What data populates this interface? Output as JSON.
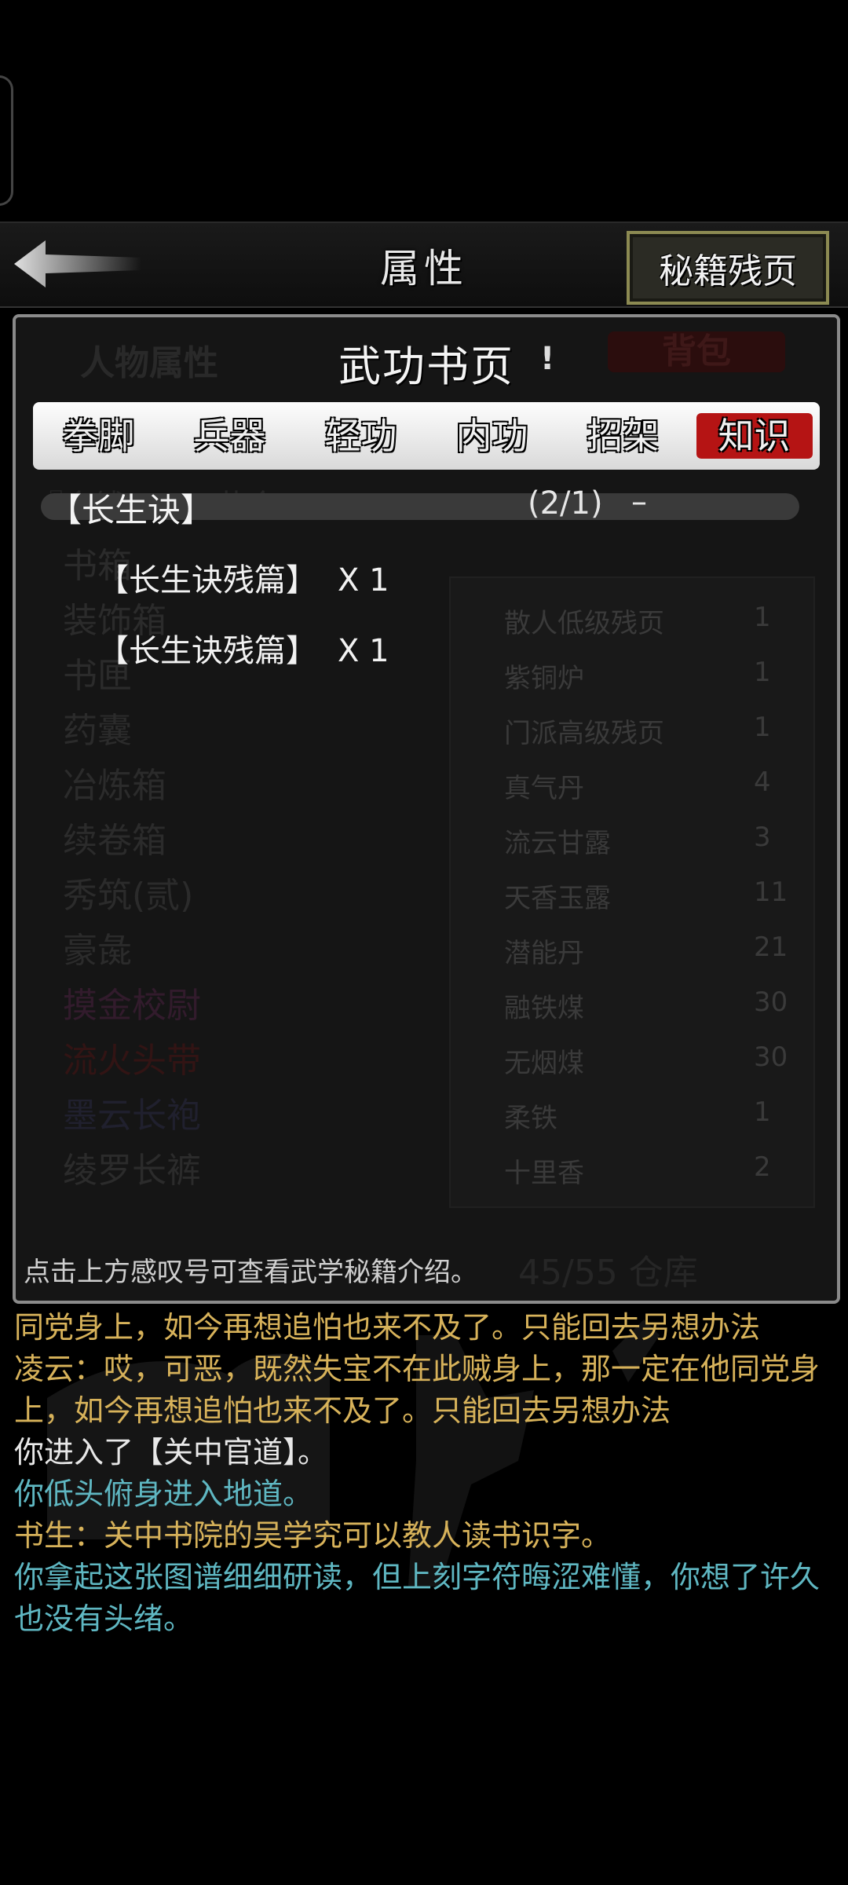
{
  "header": {
    "title": "属性",
    "secret_pages_button": "秘籍残页"
  },
  "background_panel": {
    "left_tab": "人物属性",
    "right_tab": "背包",
    "partial_line": "『金钱...745黄金...",
    "rows": [
      "书箱",
      "装饰箱",
      "书匣",
      "药囊",
      "冶炼箱",
      "续卷箱",
      "秀筑(贰)",
      "豪彘",
      "摸金校尉",
      "流火头带",
      "墨云长袍",
      "绫罗长裤"
    ],
    "items": [
      {
        "name": "散人低级残页",
        "count": "1"
      },
      {
        "name": "紫铜炉",
        "count": "1"
      },
      {
        "name": "门派高级残页",
        "count": "1"
      },
      {
        "name": "真气丹",
        "count": "4"
      },
      {
        "name": "流云甘露",
        "count": "3"
      },
      {
        "name": "天香玉露",
        "count": "11"
      },
      {
        "name": "潜能丹",
        "count": "21"
      },
      {
        "name": "融铁煤",
        "count": "30"
      },
      {
        "name": "无烟煤",
        "count": "30"
      },
      {
        "name": "柔铁",
        "count": "1"
      },
      {
        "name": "十里香",
        "count": "2"
      }
    ],
    "capacity": "45/55 仓库"
  },
  "book_pages": {
    "title": "武功书页",
    "info_mark": "!",
    "tabs": [
      {
        "label": "拳脚",
        "active": false
      },
      {
        "label": "兵器",
        "active": false
      },
      {
        "label": "轻功",
        "active": false
      },
      {
        "label": "内功",
        "active": false
      },
      {
        "label": "招架",
        "active": false
      },
      {
        "label": "知识",
        "active": true
      }
    ],
    "section": {
      "name": "【长生诀】",
      "count": "(2/1)",
      "toggle": "–"
    },
    "entries": [
      {
        "name": "【长生诀残篇】",
        "qty": "X 1"
      },
      {
        "name": "【长生诀残篇】",
        "qty": "X 1"
      }
    ],
    "hint": "点击上方感叹号可查看武学秘籍介绍。"
  },
  "log": [
    {
      "text": "同党身上，如今再想追怕也来不及了。只能回去另想办法",
      "color": "gold"
    },
    {
      "text": "凌云：哎，可恶，既然失宝不在此贼身上，那一定在他同党身上，如今再想追怕也来不及了。只能回去另想办法",
      "color": "gold"
    },
    {
      "text": "你进入了【关中官道】。",
      "color": "white"
    },
    {
      "text": "你低头俯身进入地道。",
      "color": "cyan"
    },
    {
      "text": "书生：关中书院的吴学究可以教人读书识字。",
      "color": "gold"
    },
    {
      "text": "你拿起这张图谱细细研读，但上刻字符晦涩难懂，你想了许久也没有头绪。",
      "color": "cyan"
    }
  ],
  "colors": {
    "active_tab": "#b51414",
    "log_gold": "#d7b25a",
    "log_cyan": "#5fb7c2",
    "button_border": "#8c8a52"
  }
}
